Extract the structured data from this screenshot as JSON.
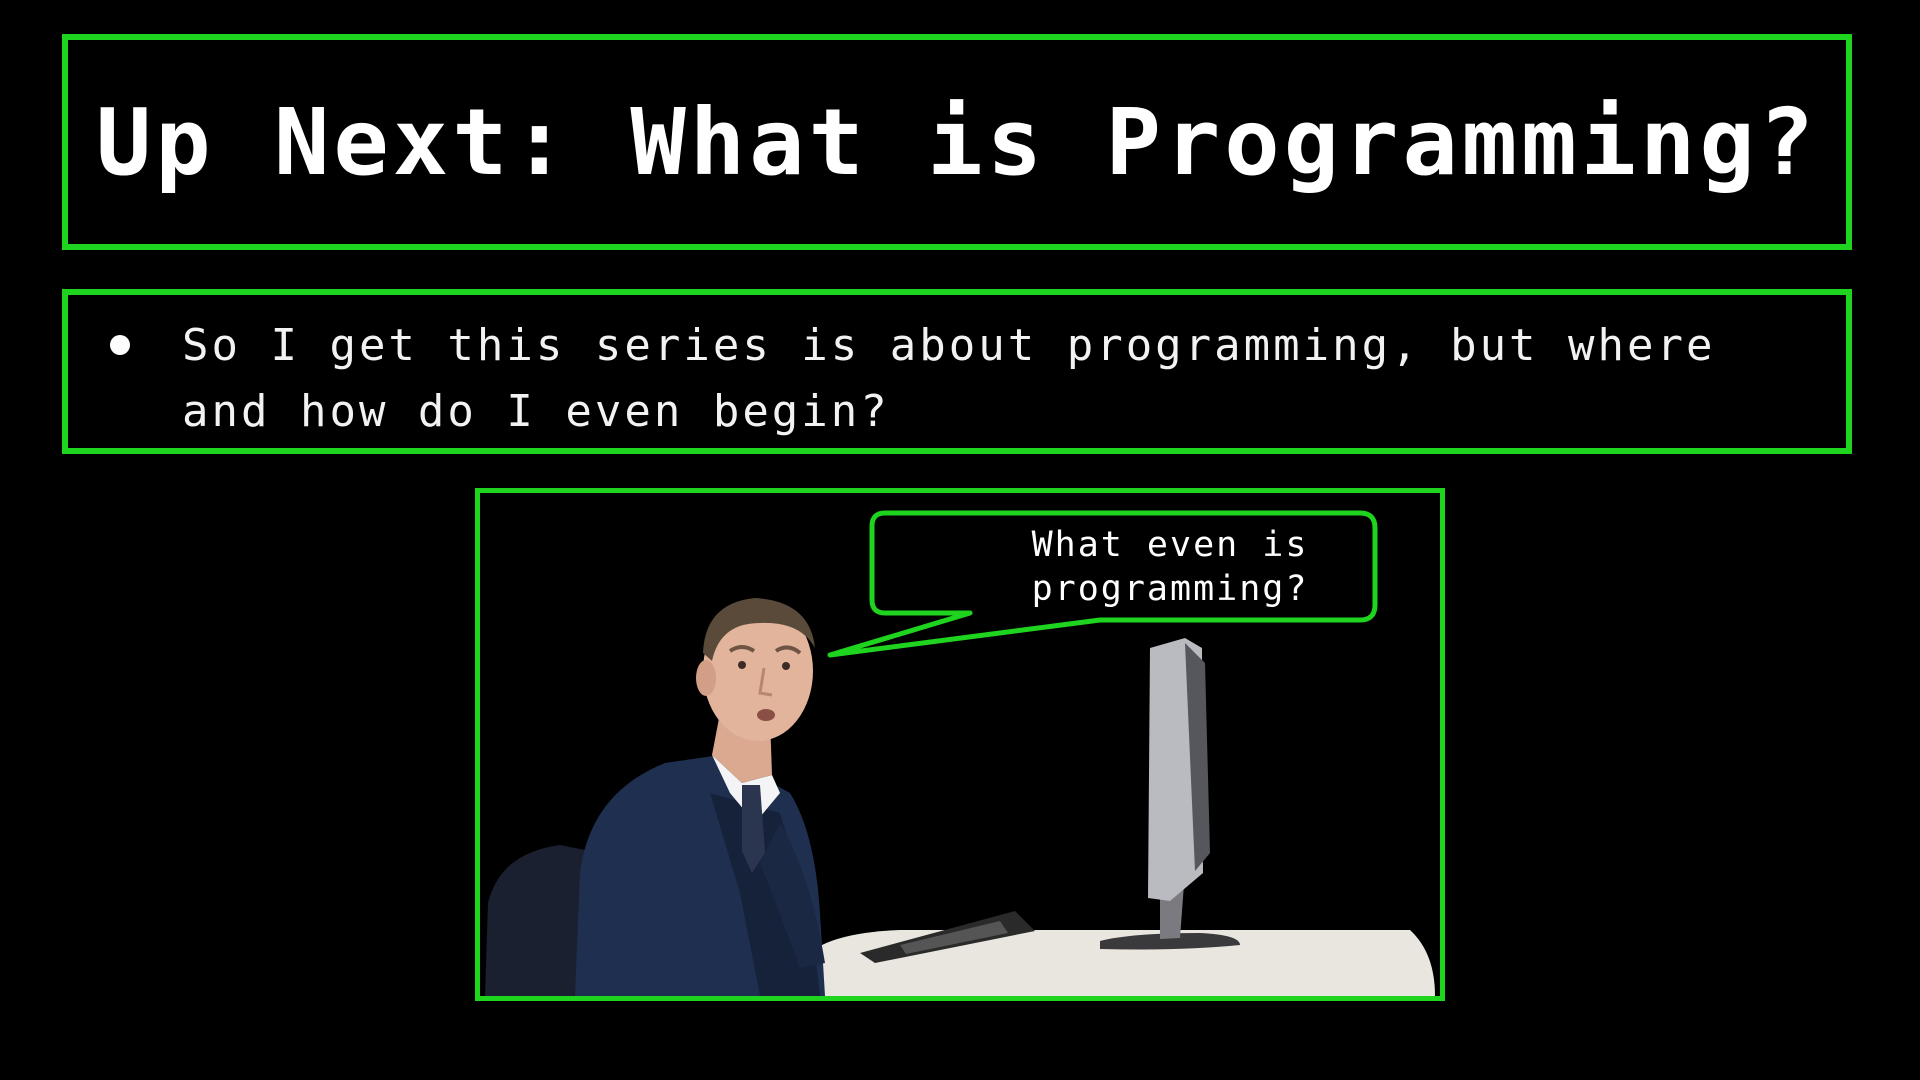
{
  "slide": {
    "title": "Up Next: What is Programming?",
    "bullets": [
      "So I get this series is about programming, but where and how do I even begin?"
    ],
    "image": {
      "speech_bubble": "What even is programming?"
    }
  },
  "colors": {
    "background": "#000000",
    "accent_border": "#1fd41f",
    "text": "#ffffff"
  }
}
